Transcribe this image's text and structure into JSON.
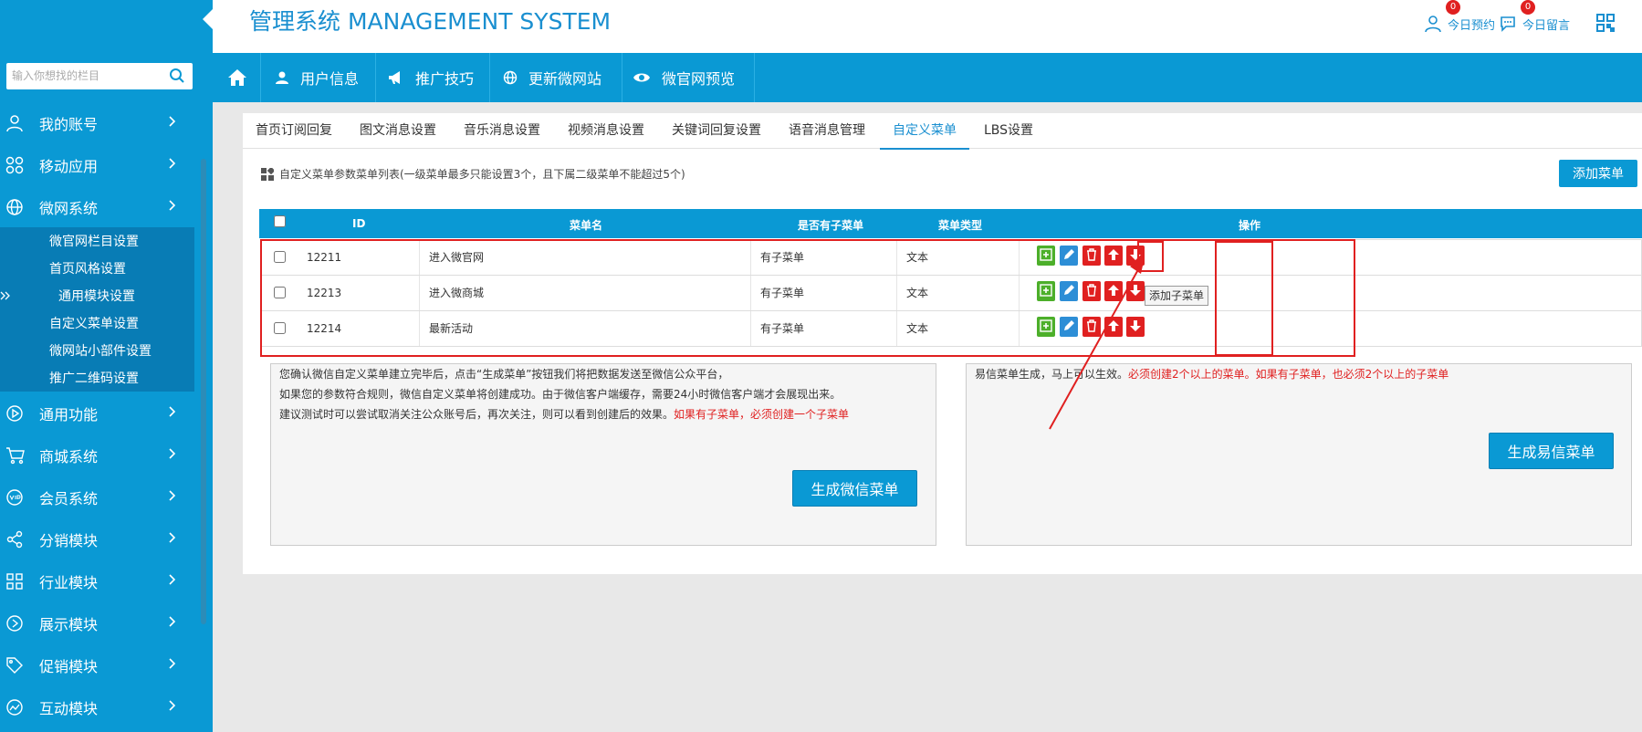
{
  "header": {
    "title": "管理系统 MANAGEMENT SYSTEM",
    "appointments": {
      "label": "今日预约",
      "count": "0"
    },
    "messages": {
      "label": "今日留言",
      "count": "0"
    }
  },
  "sidebar": {
    "search_placeholder": "输入你想找的栏目",
    "items": [
      {
        "label": "我的账号",
        "icon": "user-icon"
      },
      {
        "label": "移动应用",
        "icon": "apps-icon"
      },
      {
        "label": "微网系统",
        "icon": "globe-icon"
      },
      {
        "label": "通用功能",
        "icon": "play-icon"
      },
      {
        "label": "商城系统",
        "icon": "cart-icon"
      },
      {
        "label": "会员系统",
        "icon": "vip-icon"
      },
      {
        "label": "分销模块",
        "icon": "share-icon"
      },
      {
        "label": "行业模块",
        "icon": "grid-icon"
      },
      {
        "label": "展示模块",
        "icon": "display-icon"
      },
      {
        "label": "促销模块",
        "icon": "tag-icon"
      },
      {
        "label": "互动模块",
        "icon": "chart-icon"
      }
    ],
    "submenu": [
      {
        "label": "微官网栏目设置"
      },
      {
        "label": "首页风格设置"
      },
      {
        "label": "通用模块设置"
      },
      {
        "label": "自定义菜单设置"
      },
      {
        "label": "微网站小部件设置"
      },
      {
        "label": "推广二维码设置"
      }
    ]
  },
  "navbar": {
    "tabs": [
      {
        "label": "用户信息"
      },
      {
        "label": "推广技巧"
      },
      {
        "label": "更新微网站"
      },
      {
        "label": "微官网预览"
      }
    ]
  },
  "tabs": [
    {
      "label": "首页订阅回复"
    },
    {
      "label": "图文消息设置"
    },
    {
      "label": "音乐消息设置"
    },
    {
      "label": "视频消息设置"
    },
    {
      "label": "关键词回复设置"
    },
    {
      "label": "语音消息管理"
    },
    {
      "label": "自定义菜单"
    },
    {
      "label": "LBS设置"
    }
  ],
  "info_text": "自定义菜单参数菜单列表(一级菜单最多只能设置3个，且下属二级菜单不能超过5个)",
  "add_menu_label": "添加菜单",
  "table": {
    "headers": {
      "id": "ID",
      "name": "菜单名",
      "has_sub": "是否有子菜单",
      "type": "菜单类型",
      "ops": "操作"
    },
    "rows": [
      {
        "id": "12211",
        "name": "进入微官网",
        "has_sub": "有子菜单",
        "type": "文本"
      },
      {
        "id": "12213",
        "name": "进入微商城",
        "has_sub": "有子菜单",
        "type": "文本"
      },
      {
        "id": "12214",
        "name": "最新活动",
        "has_sub": "有子菜单",
        "type": "文本"
      }
    ]
  },
  "tooltip": "添加子菜单",
  "wechat_panel": {
    "line1": "您确认微信自定义菜单建立完毕后，点击“生成菜单”按钮我们将把数据发送至微信公众平台，",
    "line2": "如果您的参数符合规则，微信自定义菜单将创建成功。由于微信客户端缓存，需要24小时微信客户端才会展现出来。",
    "line3": "建议测试时可以尝试取消关注公众账号后，再次关注，则可以看到创建后的效果。",
    "line3_red": "如果有子菜单，必须创建一个子菜单",
    "button": "生成微信菜单"
  },
  "yixin_panel": {
    "text": "易信菜单生成，马上可以生效。",
    "text_red": "必须创建2个以上的菜单。如果有子菜单，也必须2个以上的子菜单",
    "button": "生成易信菜单"
  },
  "colors": {
    "brand": "#0a99d4",
    "highlight": "#e02020"
  }
}
